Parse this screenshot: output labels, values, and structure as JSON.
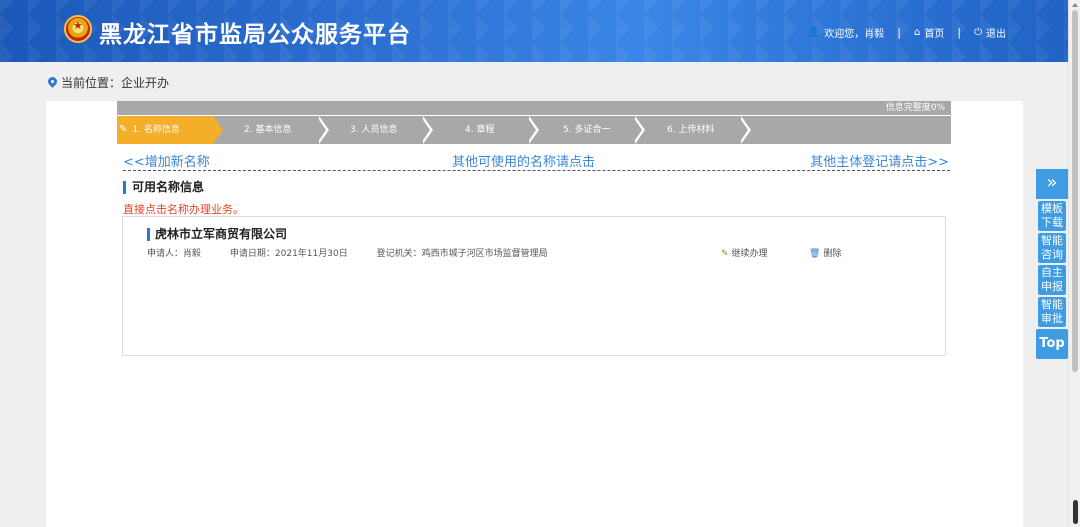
{
  "header": {
    "title": "黑龙江省市监局公众服务平台",
    "welcome": "欢迎您，肖毅",
    "home": "首页",
    "logout": "退出"
  },
  "breadcrumb": {
    "label": "当前位置：企业开办"
  },
  "progress": {
    "completion_label": "信息完整度0%",
    "completion_value": 0,
    "steps": [
      {
        "label": "1. 名称信息",
        "active": true
      },
      {
        "label": "2. 基本信息",
        "active": false
      },
      {
        "label": "3. 人员信息",
        "active": false
      },
      {
        "label": "4. 章程",
        "active": false
      },
      {
        "label": "5. 多证合一",
        "active": false
      },
      {
        "label": "6. 上传材料",
        "active": false
      }
    ]
  },
  "links": {
    "add_name": "<<增加新名称",
    "other_names": "其他可使用的名称请点击",
    "other_entity": "其他主体登记请点击>>"
  },
  "section": {
    "title": "可用名称信息",
    "hint": "直接点击名称办理业务。"
  },
  "record": {
    "company": "虎林市立军商贸有限公司",
    "applicant": "申请人：肖毅",
    "date": "申请日期：2021年11月30日",
    "authority": "登记机关：鸡西市城子河区市场监督管理局",
    "continue": "继续办理",
    "delete": "删除"
  },
  "sidebar": {
    "items": [
      {
        "label": "模板下载"
      },
      {
        "label": "智能咨询"
      },
      {
        "label": "自主申报"
      },
      {
        "label": "智能审批"
      }
    ],
    "top": "Top"
  },
  "colors": {
    "header_blue": "#2f73d6",
    "active_step": "#f3ae2a",
    "link_blue": "#3b86d8",
    "hint_red": "#e0462a",
    "sidebar_blue": "#3f9be2"
  }
}
